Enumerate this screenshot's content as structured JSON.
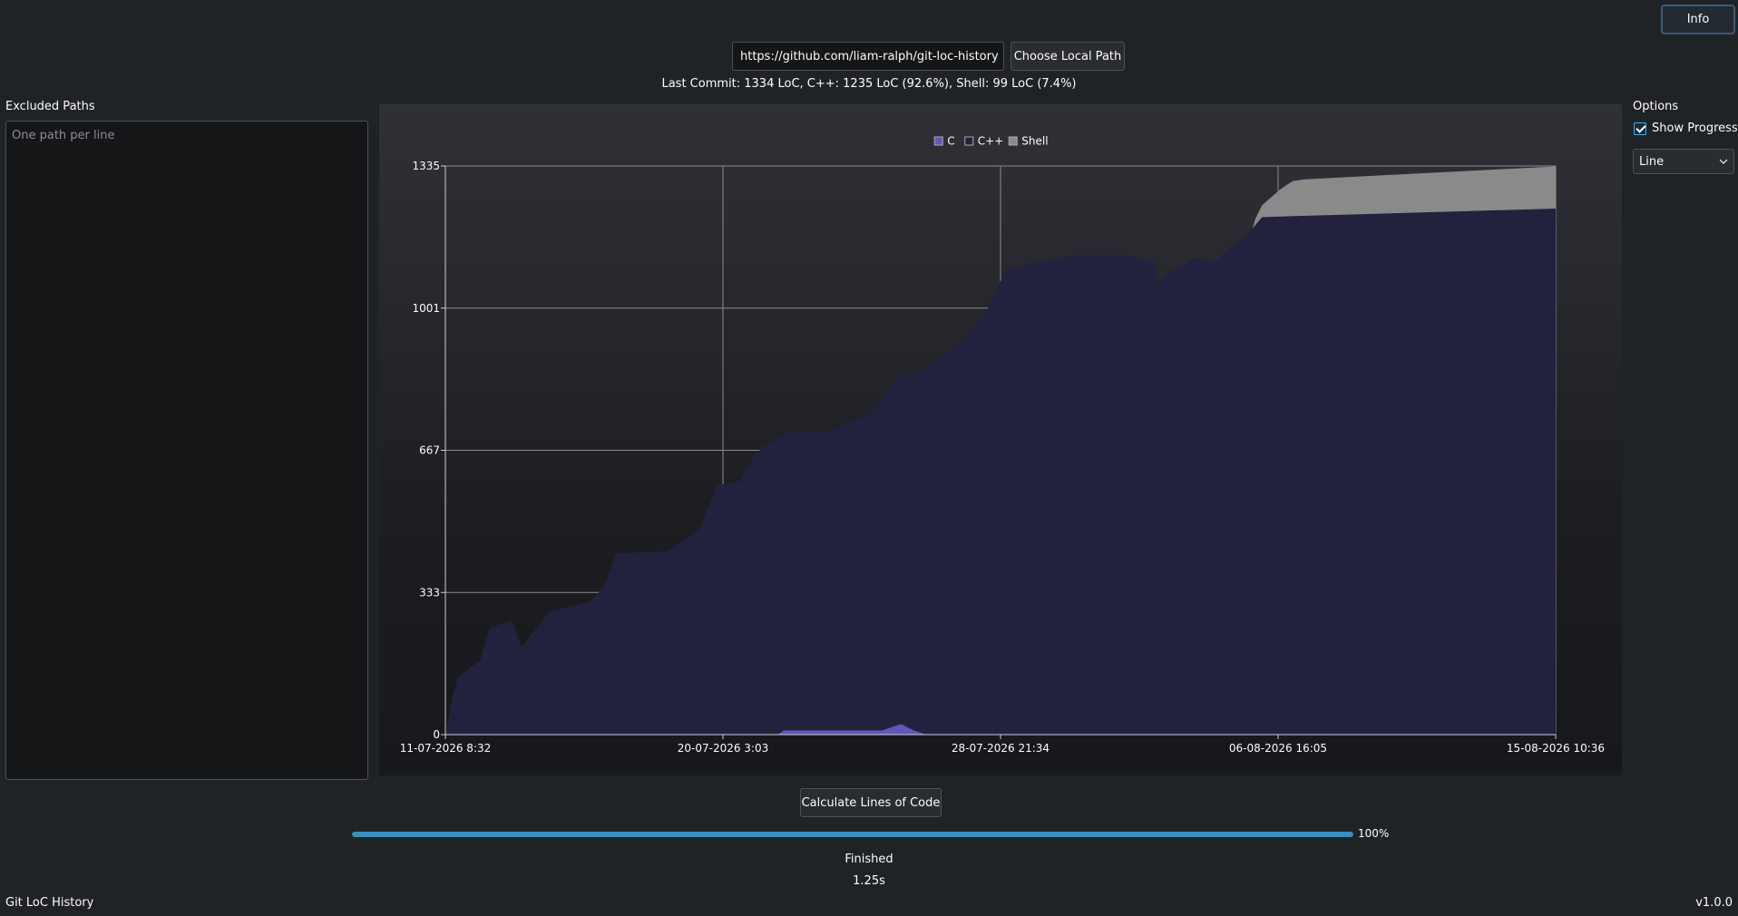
{
  "header": {
    "info_label": "Info"
  },
  "source": {
    "url_value": "https://github.com/liam-ralph/git-loc-history",
    "choose_path_label": "Choose Local Path"
  },
  "last_commit_text": "Last Commit: 1334 LoC, C++: 1235 LoC (92.6%), Shell: 99 LoC (7.4%)",
  "excluded": {
    "label": "Excluded Paths",
    "placeholder": "One path per line"
  },
  "options": {
    "label": "Options",
    "show_progress_label": "Show Progress",
    "show_progress_checked": true,
    "chart_type_value": "Line"
  },
  "actions": {
    "calculate_label": "Calculate Lines of Code"
  },
  "progress": {
    "value": 1.0,
    "percent_label": "100%",
    "status": "Finished",
    "elapsed": "1.25s"
  },
  "footer": {
    "app_name": "Git LoC History",
    "version": "v1.0.0"
  },
  "colors": {
    "C": "#6257b8",
    "C++": "#22223f",
    "Shell": "#8a8a8a",
    "accent": "#3daee9"
  },
  "chart_data": {
    "type": "area",
    "legend": [
      "C",
      "C++",
      "Shell"
    ],
    "legend_position": "top-center",
    "ylim": [
      0,
      1335
    ],
    "yticks": [
      "0",
      "333",
      "667",
      "1001",
      "1335"
    ],
    "xticks": [
      "11-07-2026 8:32",
      "20-07-2026 3:03",
      "28-07-2026 21:34",
      "06-08-2026 16:05",
      "15-08-2026 10:36"
    ],
    "x_range_days": [
      0,
      35.08
    ],
    "grid": true,
    "series": [
      {
        "name": "C",
        "points": [
          [
            0,
            0
          ],
          [
            10.5,
            0
          ],
          [
            10.7,
            10
          ],
          [
            13,
            10
          ],
          [
            13.8,
            10
          ],
          [
            14.4,
            25
          ],
          [
            14.8,
            10
          ],
          [
            15.2,
            0
          ],
          [
            35.08,
            0
          ]
        ]
      },
      {
        "name": "C++",
        "points": [
          [
            0,
            0
          ],
          [
            0.2,
            80
          ],
          [
            0.4,
            135
          ],
          [
            1.1,
            175
          ],
          [
            1.4,
            250
          ],
          [
            2.1,
            270
          ],
          [
            2.4,
            205
          ],
          [
            3.3,
            290
          ],
          [
            4.5,
            310
          ],
          [
            5.0,
            345
          ],
          [
            5.4,
            425
          ],
          [
            7.0,
            430
          ],
          [
            8.0,
            480
          ],
          [
            8.6,
            585
          ],
          [
            9.3,
            595
          ],
          [
            9.8,
            660
          ],
          [
            10.5,
            700
          ],
          [
            12.0,
            700
          ],
          [
            13.3,
            740
          ],
          [
            13.7,
            770
          ],
          [
            14.3,
            820
          ],
          [
            14.9,
            840
          ],
          [
            15.5,
            880
          ],
          [
            16.3,
            920
          ],
          [
            17.0,
            980
          ],
          [
            17.7,
            1090
          ],
          [
            18.6,
            1110
          ],
          [
            19.8,
            1125
          ],
          [
            21.5,
            1125
          ],
          [
            22.4,
            1110
          ],
          [
            22.5,
            1060
          ],
          [
            22.9,
            1085
          ],
          [
            23.4,
            1105
          ],
          [
            23.6,
            1120
          ],
          [
            24.3,
            1110
          ],
          [
            24.8,
            1145
          ],
          [
            25.3,
            1170
          ],
          [
            25.8,
            1215
          ],
          [
            35.08,
            1235
          ]
        ]
      },
      {
        "name": "Shell",
        "points": [
          [
            0,
            0
          ],
          [
            25.5,
            0
          ],
          [
            25.6,
            15
          ],
          [
            26.4,
            65
          ],
          [
            26.7,
            79
          ],
          [
            26.8,
            83
          ],
          [
            27.2,
            86
          ],
          [
            35.08,
            99
          ]
        ]
      }
    ]
  }
}
